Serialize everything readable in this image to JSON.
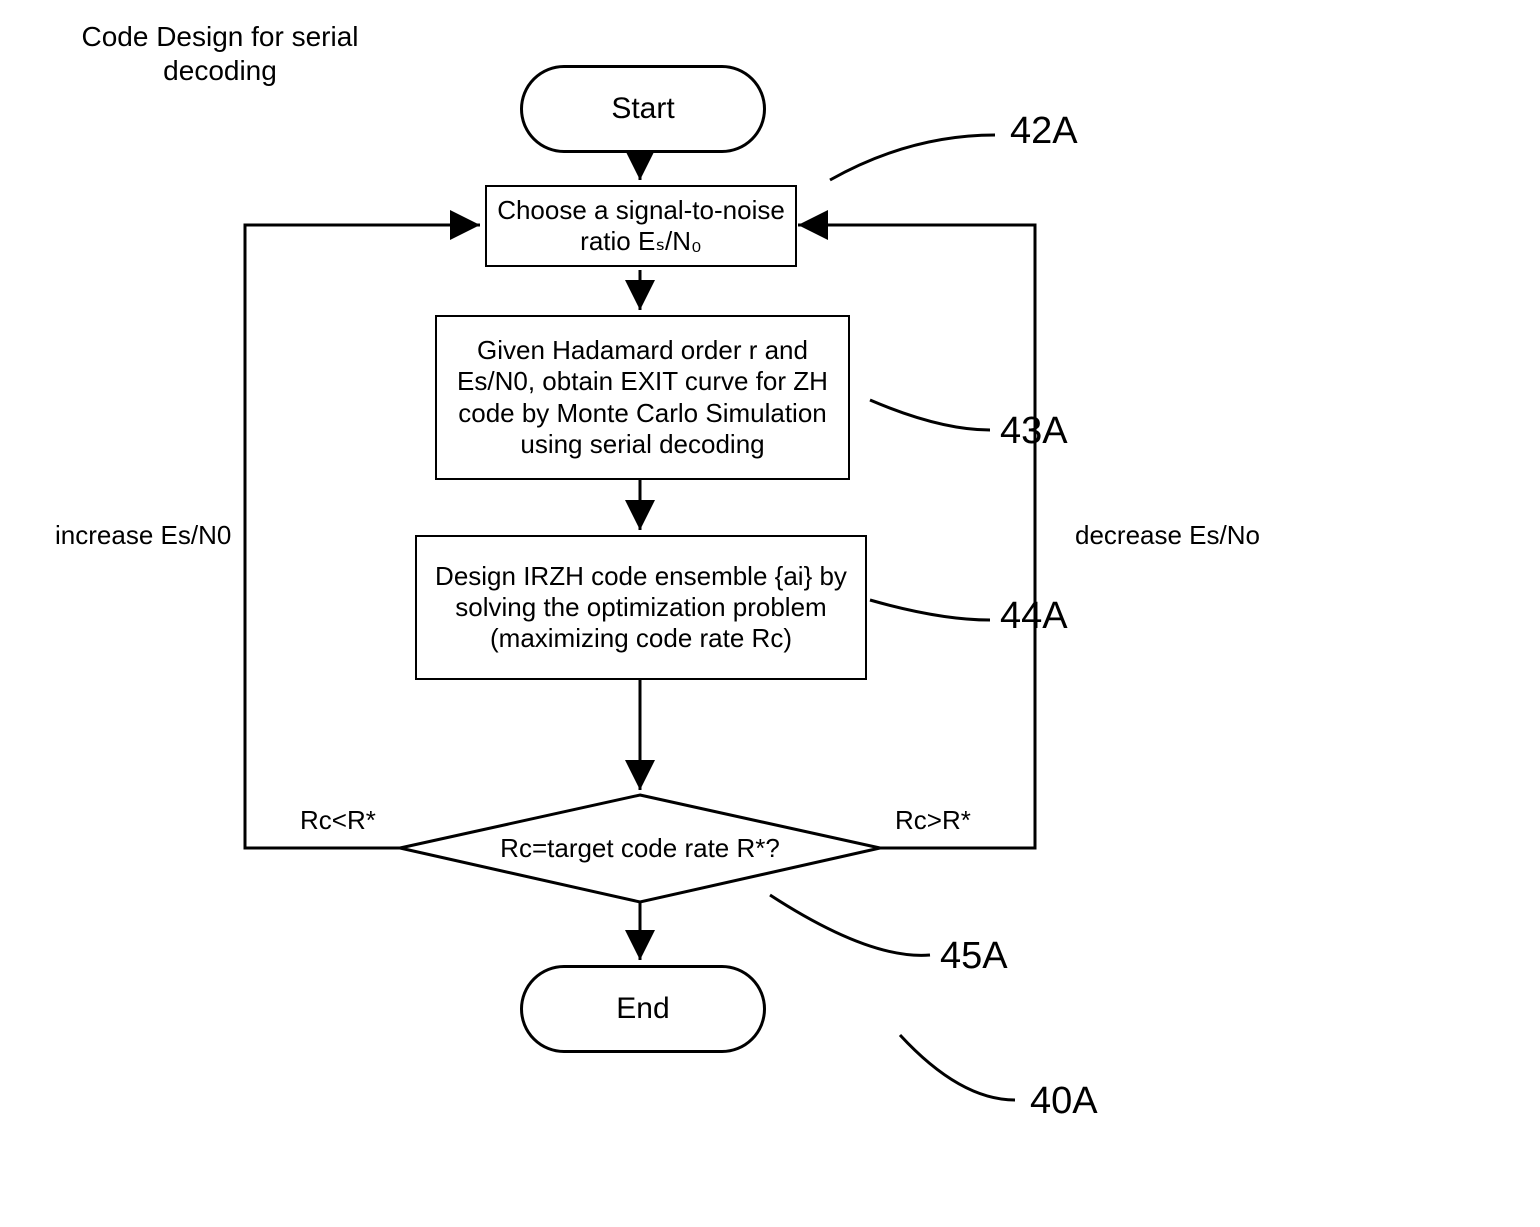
{
  "title": "Code Design for serial decoding",
  "start": "Start",
  "end": "End",
  "box42A": "Choose a signal-to-noise ratio  Eₛ/N₀",
  "box43A": "Given Hadamard order r and Es/N0, obtain EXIT curve for ZH code by Monte Carlo Simulation using serial decoding",
  "box44A": "Design IRZH code ensemble {ai} by solving the optimization problem (maximizing code rate Rc)",
  "decision": "Rc=target code rate R*?",
  "left_path": "Rc<R*",
  "right_path": "Rc>R*",
  "left_action": "increase  Es/N0",
  "right_action": "decrease Es/No",
  "ref42A": "42A",
  "ref43A": "43A",
  "ref44A": "44A",
  "ref45A": "45A",
  "ref40A": "40A"
}
